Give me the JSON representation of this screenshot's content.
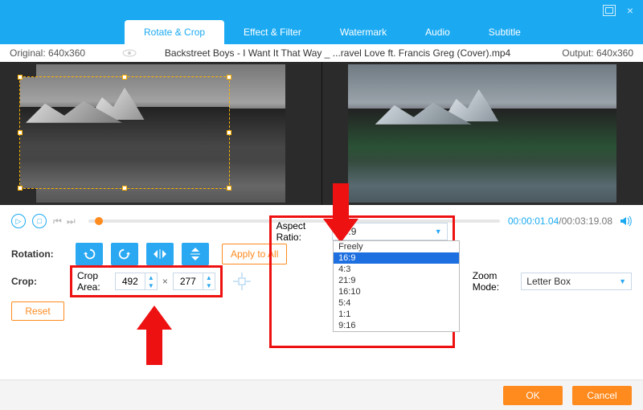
{
  "tabs": {
    "rotate": "Rotate & Crop",
    "effect": "Effect & Filter",
    "watermark": "Watermark",
    "audio": "Audio",
    "subtitle": "Subtitle"
  },
  "info": {
    "original_label": "Original:",
    "original_dim": "640x360",
    "filename": "Backstreet Boys - I Want It That Way _ ...ravel Love ft. Francis Greg (Cover).mp4",
    "output_label": "Output:",
    "output_dim": "640x360"
  },
  "transport": {
    "current": "00:00:01.04",
    "total": "00:03:19.08"
  },
  "rotation": {
    "label": "Rotation:",
    "apply_all": "Apply to All"
  },
  "crop": {
    "label": "Crop:",
    "area_label": "Crop Area:",
    "width": "492",
    "times": "×",
    "height": "277",
    "reset": "Reset"
  },
  "aspect": {
    "label": "Aspect Ratio:",
    "value": "16:9",
    "options": [
      "Freely",
      "16:9",
      "4:3",
      "21:9",
      "16:10",
      "5:4",
      "1:1",
      "9:16"
    ],
    "selected_index": 1
  },
  "zoom": {
    "label": "Zoom Mode:",
    "value": "Letter Box"
  },
  "footer": {
    "ok": "OK",
    "cancel": "Cancel"
  }
}
